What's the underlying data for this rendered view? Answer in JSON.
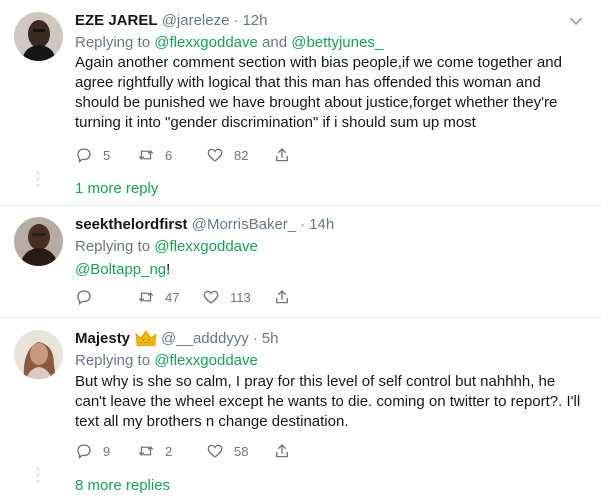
{
  "tweets": [
    {
      "name": "EZE JAREL",
      "handle": "@jareleze",
      "time": "12h",
      "replying_prefix": "Replying to ",
      "replying_to": [
        "@flexxgoddave",
        "@bettyjunes_"
      ],
      "replying_joiner": " and ",
      "text": "Again another comment section with bias people,if we come together and agree rightfully with logical that this man has offended this woman and should be punished we have brought about justice,forget whether they're turning it into \"gender discrimination\" if i should sum up most",
      "replies": "5",
      "retweets": "6",
      "likes": "82",
      "more_replies": "1 more reply"
    },
    {
      "name": "seekthelordfirst",
      "handle": "@MorrisBaker_",
      "time": "14h",
      "replying_prefix": "Replying to ",
      "replying_to": [
        "@flexxgoddave"
      ],
      "mention": "@Boltapp_ng",
      "mention_suffix": "!",
      "replies": "",
      "retweets": "47",
      "likes": "113"
    },
    {
      "name": "Majesty",
      "crown_icon": "crown-emoji",
      "handle": "@__adddyyy",
      "time": "5h",
      "replying_prefix": "Replying to ",
      "replying_to": [
        "@flexxgoddave"
      ],
      "text": "But why is she so calm, I pray for this level of self control but nahhhh, he can't leave the wheel except he wants to die. coming on twitter to report?. I'll text all my brothers n change destination.",
      "replies": "9",
      "retweets": "2",
      "likes": "58",
      "more_replies": "8 more replies"
    }
  ],
  "separator": "·",
  "colors": {
    "link_green": "#17a057",
    "secondary_text": "#657786",
    "border": "#e6ecf0"
  }
}
